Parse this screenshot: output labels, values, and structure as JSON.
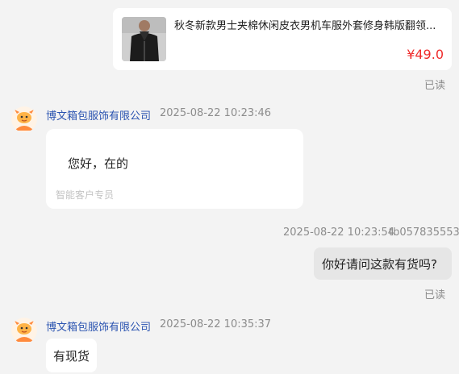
{
  "product": {
    "title": "秋冬新款男士夹棉休闲皮衣男机车服外套修身韩版翻领...",
    "price": "¥49.0",
    "read_status": "已读"
  },
  "messages": [
    {
      "sender": "博文箱包服饰有限公司",
      "time": "2025-08-22 10:23:46",
      "text": "您好，在的",
      "sub_label": "智能客户专员"
    },
    {
      "time": "2025-08-22 10:23:54",
      "user": "tb057835553",
      "text": "你好请问这款有货吗?",
      "read_status": "已读"
    },
    {
      "sender": "博文箱包服饰有限公司",
      "time": "2025-08-22 10:35:37",
      "text": "有现货"
    }
  ],
  "colors": {
    "background": "#f3f3f3",
    "sender_name": "#2a53b0",
    "price": "#ef2b2b",
    "outgoing_bubble": "#e6e6e6"
  },
  "icons": {
    "avatar": "orange-mascot-avatar-icon",
    "product_image": "black-leather-jacket-image"
  }
}
